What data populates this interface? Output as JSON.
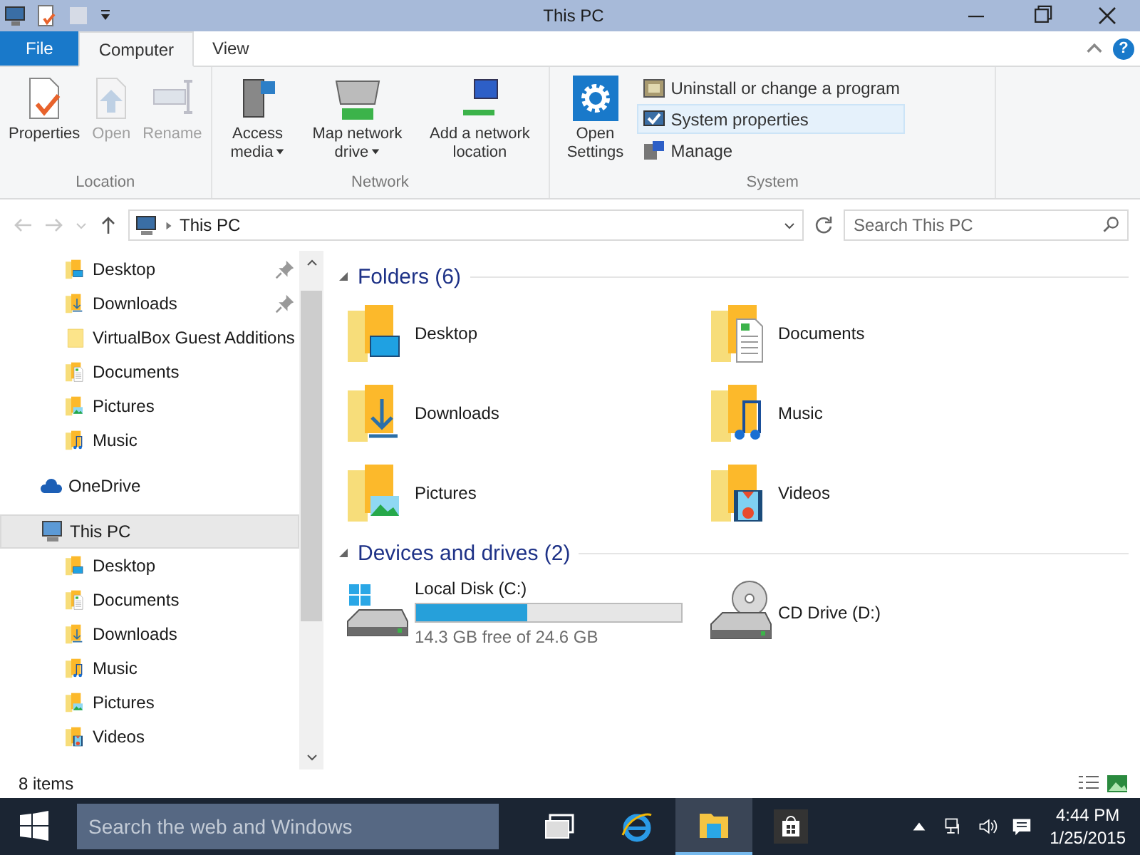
{
  "window": {
    "title": "This PC"
  },
  "tabs": [
    {
      "label": "File",
      "kind": "file",
      "selected": false
    },
    {
      "label": "Computer",
      "kind": "tab",
      "selected": true
    },
    {
      "label": "View",
      "kind": "tab",
      "selected": false
    }
  ],
  "help": "?",
  "ribbon": {
    "groups": [
      {
        "label": "Location",
        "buttons": [
          {
            "label": "Properties",
            "kind": "properties",
            "disabled": false,
            "dropdown": false
          },
          {
            "label": "Open",
            "kind": "open",
            "disabled": true,
            "dropdown": false
          },
          {
            "label": "Rename",
            "kind": "rename",
            "disabled": true,
            "dropdown": false
          }
        ]
      },
      {
        "label": "Network",
        "buttons": [
          {
            "label": "Access media",
            "kind": "media",
            "disabled": false,
            "dropdown": true
          },
          {
            "label": "Map network drive",
            "kind": "mapdrive",
            "disabled": false,
            "dropdown": true
          },
          {
            "label": "Add a network location",
            "kind": "netloc",
            "disabled": false,
            "dropdown": false
          }
        ]
      },
      {
        "label": "System",
        "buttons": [
          {
            "label": "Open Settings",
            "kind": "settings",
            "disabled": false,
            "dropdown": false
          }
        ],
        "small_buttons": [
          {
            "label": "Uninstall or change a program",
            "kind": "uninstall",
            "highlighted": false
          },
          {
            "label": "System properties",
            "kind": "sysprops",
            "highlighted": true
          },
          {
            "label": "Manage",
            "kind": "manage",
            "highlighted": false
          }
        ]
      }
    ]
  },
  "address_bar": {
    "path": "This PC",
    "search_placeholder": "Search This PC"
  },
  "sidebar": {
    "quick_access": [
      {
        "label": "Desktop",
        "kind": "desktop",
        "pinned": true
      },
      {
        "label": "Downloads",
        "kind": "downloads",
        "pinned": true
      },
      {
        "label": "VirtualBox Guest Additions",
        "kind": "plain",
        "pinned": false
      },
      {
        "label": "Documents",
        "kind": "documents",
        "pinned": false
      },
      {
        "label": "Pictures",
        "kind": "pictures",
        "pinned": false
      },
      {
        "label": "Music",
        "kind": "music",
        "pinned": false
      }
    ],
    "items": [
      {
        "label": "OneDrive",
        "kind": "onedrive",
        "selected": false
      },
      {
        "label": "This PC",
        "kind": "pc",
        "selected": true,
        "children": [
          {
            "label": "Desktop",
            "kind": "desktop"
          },
          {
            "label": "Documents",
            "kind": "documents"
          },
          {
            "label": "Downloads",
            "kind": "downloads"
          },
          {
            "label": "Music",
            "kind": "music"
          },
          {
            "label": "Pictures",
            "kind": "pictures"
          },
          {
            "label": "Videos",
            "kind": "videos"
          }
        ]
      }
    ]
  },
  "folders": {
    "title": "Folders (6)",
    "items": [
      {
        "label": "Desktop",
        "kind": "desktop"
      },
      {
        "label": "Documents",
        "kind": "documents"
      },
      {
        "label": "Downloads",
        "kind": "downloads"
      },
      {
        "label": "Music",
        "kind": "music"
      },
      {
        "label": "Pictures",
        "kind": "pictures"
      },
      {
        "label": "Videos",
        "kind": "videos"
      }
    ]
  },
  "drives": {
    "title": "Devices and drives (2)",
    "items": [
      {
        "label": "Local Disk (C:)",
        "kind": "disk",
        "level": 0.42,
        "free": "14.3 GB free of 24.6 GB"
      },
      {
        "label": "CD Drive (D:)",
        "kind": "cd"
      }
    ]
  },
  "status_bar": {
    "count": "8 items"
  },
  "taskbar": {
    "search_placeholder": "Search the web and Windows",
    "apps": [
      {
        "kind": "taskview",
        "active": false
      },
      {
        "kind": "browser",
        "active": false
      },
      {
        "kind": "explorer",
        "active": true
      },
      {
        "kind": "store",
        "active": false
      }
    ],
    "time": "4:44 PM",
    "date": "1/25/2015"
  }
}
